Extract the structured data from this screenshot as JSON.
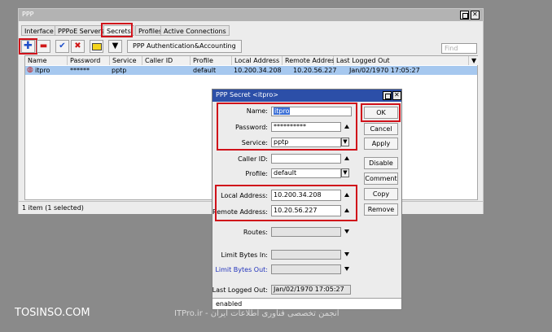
{
  "ppp_window": {
    "title": "PPP",
    "tabs": [
      "Interface",
      "PPPoE Servers",
      "Secrets",
      "Profiles",
      "Active Connections"
    ],
    "active_tab": "Secrets",
    "toolbar": {
      "add_icon": "plus-icon",
      "remove_icon": "minus-icon",
      "enable_icon": "check-icon",
      "disable_icon": "x-icon",
      "comment_icon": "note-icon",
      "filter_icon": "filter-icon",
      "auth_button": "PPP Authentication&Accounting"
    },
    "find_placeholder": "Find",
    "columns": [
      "Name",
      "Password",
      "Service",
      "Caller ID",
      "Profile",
      "Local Address",
      "Remote Address",
      "Last Logged Out"
    ],
    "rows": [
      {
        "name": "itpro",
        "password": "******",
        "service": "pptp",
        "caller_id": "",
        "profile": "default",
        "local_address": "10.200.34.208",
        "remote_address": "10.20.56.227",
        "last_logged_out": "Jan/02/1970 17:05:27"
      }
    ],
    "status": "1 item (1 selected)"
  },
  "secret_dialog": {
    "title": "PPP Secret <itpro>",
    "name_label": "Name:",
    "name_value": "itpro",
    "password_label": "Password:",
    "password_value": "**********",
    "service_label": "Service:",
    "service_value": "pptp",
    "caller_id_label": "Caller ID:",
    "caller_id_value": "",
    "profile_label": "Profile:",
    "profile_value": "default",
    "local_address_label": "Local Address:",
    "local_address_value": "10.200.34.208",
    "remote_address_label": "Remote Address:",
    "remote_address_value": "10.20.56.227",
    "routes_label": "Routes:",
    "routes_value": "",
    "limit_in_label": "Limit Bytes In:",
    "limit_in_value": "",
    "limit_out_label": "Limit Bytes Out:",
    "limit_out_value": "",
    "last_logged_label": "Last Logged Out:",
    "last_logged_value": "Jan/02/1970 17:05:27",
    "buttons": {
      "ok": "OK",
      "cancel": "Cancel",
      "apply": "Apply",
      "disable": "Disable",
      "comment": "Comment",
      "copy": "Copy",
      "remove": "Remove"
    },
    "status": "enabled"
  },
  "watermark": {
    "site": "TOSINSO.COM",
    "fa": "ITPro.ir - انجمن تخصصی فناوری اطلاعات ایران"
  },
  "colors": {
    "highlight": "#d0111a",
    "selected_row": "#a6c8ef",
    "dialog_title": "#2c4fa8"
  }
}
